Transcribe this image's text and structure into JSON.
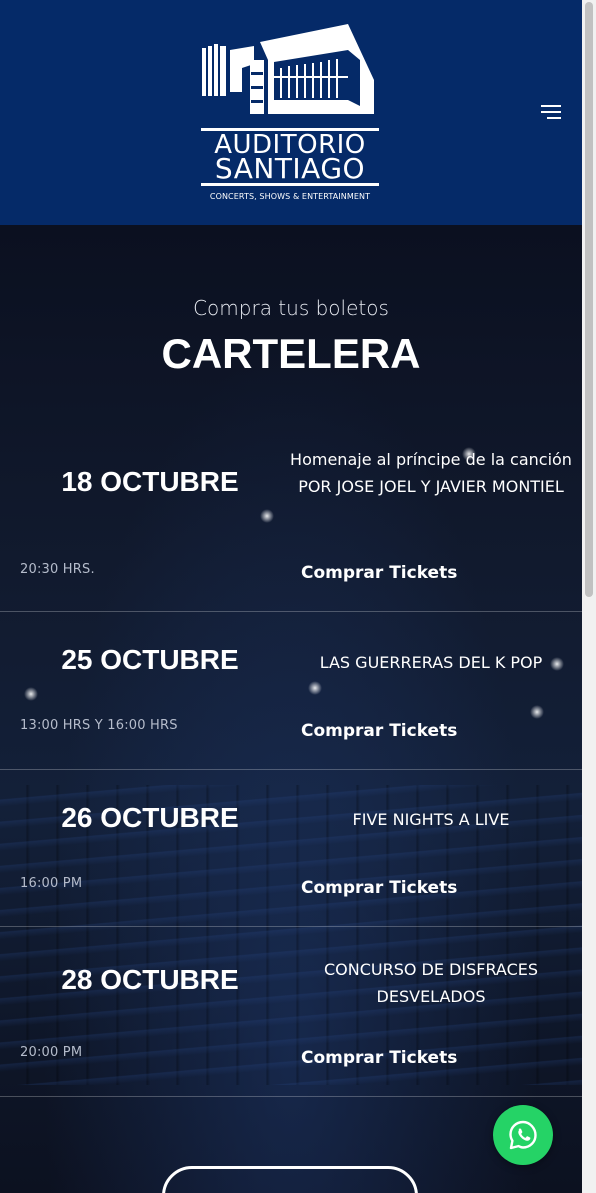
{
  "header": {
    "logo": {
      "line1": "AUDITORIO",
      "line2": "SANTIAGO",
      "tagline": "CONCERTS, SHOWS & ENTERTAINMENT"
    },
    "menu_icon": "hamburger-menu-icon",
    "background_color": "#052a68"
  },
  "hero": {
    "subtitle": "Compra tus boletos",
    "title": "CARTELERA"
  },
  "events": [
    {
      "date": "18 OCTUBRE",
      "name": "Homenaje al príncipe de la canción POR JOSE JOEL Y JAVIER MONTIEL",
      "time": "20:30 HRS.",
      "button": "Comprar Tickets"
    },
    {
      "date": "25 OCTUBRE",
      "name": "LAS GUERRERAS DEL K POP",
      "time": "13:00 HRS Y 16:00 HRS",
      "button": "Comprar Tickets"
    },
    {
      "date": "26 OCTUBRE",
      "name": "FIVE NIGHTS A LIVE",
      "time": "16:00 PM",
      "button": "Comprar Tickets"
    },
    {
      "date": "28 OCTUBRE",
      "name": "CONCURSO DE DISFRACES DESVELADOS",
      "time": "20:00 PM",
      "button": "Comprar Tickets"
    }
  ],
  "floating": {
    "whatsapp_icon": "whatsapp-icon",
    "whatsapp_color": "#25d366"
  }
}
